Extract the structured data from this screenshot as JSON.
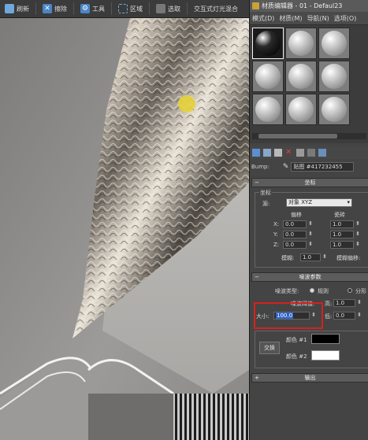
{
  "viewport_toolbar": {
    "items": [
      {
        "label": "刷新",
        "icon": "refresh-icon",
        "color": "#6fa8dc"
      },
      {
        "label": "擦除",
        "icon": "erase-icon",
        "color": "#4a86c6"
      },
      {
        "label": "工具",
        "icon": "tools-icon",
        "color": "#4a86c6"
      },
      {
        "label": "区域",
        "icon": "region-icon",
        "color": "#4a86c6"
      },
      {
        "label": "选取",
        "icon": "pick-icon",
        "color": "#777777"
      },
      {
        "label": "交互式灯光混合",
        "icon": "",
        "color": ""
      }
    ]
  },
  "editor": {
    "title": "材质编辑器 - 01 - Defaul23",
    "menu": [
      "模式(D)",
      "材质(M)",
      "导航(N)",
      "选项(O)"
    ],
    "slots": {
      "rows": 3,
      "cols": 3,
      "active_index": 0
    },
    "bump": {
      "label": "Bump:",
      "map_name": "贴图 #417232455"
    },
    "coords": {
      "header": "坐标",
      "group_label": "坐标",
      "source_label": "源:",
      "source_value": "对象 XYZ",
      "offset_label": "偏移",
      "tiling_label": "瓷砖",
      "axes": [
        "X:",
        "Y:",
        "Z:"
      ],
      "offset": [
        "0.0",
        "0.0",
        "0.0"
      ],
      "tiling": [
        "1.0",
        "1.0",
        "1.0"
      ],
      "blur_label": "模糊:",
      "blur_value": "1.0",
      "blur_offset_label": "模糊偏移:"
    },
    "noise": {
      "header": "噪波参数",
      "type_label": "噪波类型:",
      "type_regular": "规则",
      "type_fractal": "分形",
      "threshold_label": "噪波阈值:",
      "high_label": "高:",
      "high_value": "1.0",
      "size_label": "大小:",
      "size_value": "100.0",
      "low_label": "低:",
      "low_value": "0.0",
      "swap_label": "交换",
      "color1_label": "颜色 #1",
      "color2_label": "颜色 #2",
      "color1": "#000000",
      "color2": "#ffffff"
    },
    "output": {
      "header": "输出"
    }
  },
  "highlight_color": "#d4221c"
}
